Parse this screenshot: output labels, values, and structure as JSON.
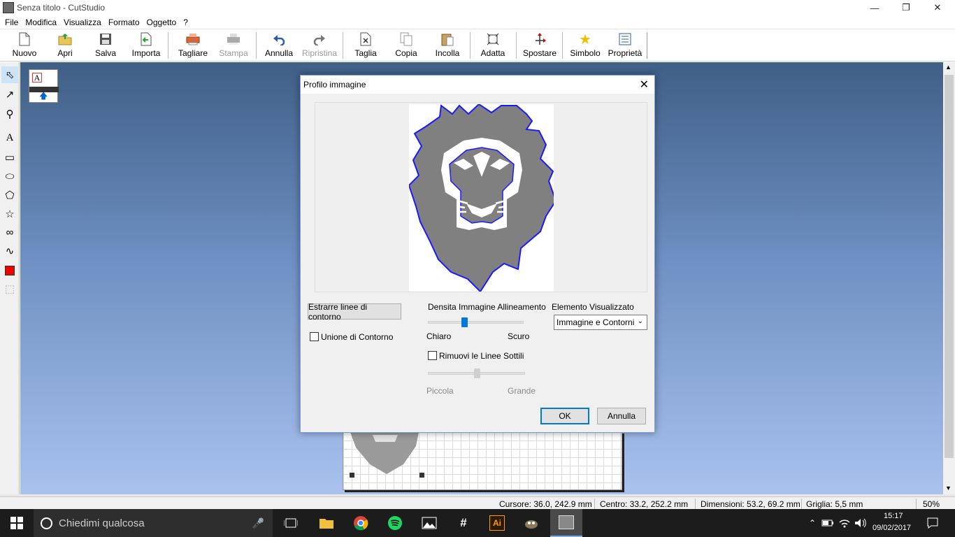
{
  "window": {
    "title": "Senza titolo - CutStudio"
  },
  "menu": [
    "File",
    "Modifica",
    "Visualizza",
    "Formato",
    "Oggetto",
    "?"
  ],
  "toolbar": {
    "new": "Nuovo",
    "open": "Apri",
    "save": "Salva",
    "import": "Importa",
    "cut_job": "Tagliare",
    "print": "Stampa",
    "undo": "Annulla",
    "redo": "Ripristina",
    "cut": "Taglia",
    "copy": "Copia",
    "paste": "Incolla",
    "fit": "Adatta",
    "move": "Spostare",
    "symbol": "Simbolo",
    "properties": "Proprietà"
  },
  "dialog": {
    "title": "Profilo immagine",
    "extract_button": "Estrarre linee di contorno",
    "union_label": "Unione di Contorno",
    "density_title": "Densita Immagine Allineamento",
    "density_min": "Chiaro",
    "density_max": "Scuro",
    "density_level": 0.38,
    "display_title": "Elemento Visualizzato",
    "display_value": "Immagine e Contorni",
    "thin_lines_label": "Rimuovi le Linee Sottili",
    "size_min": "Piccola",
    "size_max": "Grande",
    "size_level": 0.5,
    "ok": "OK",
    "cancel": "Annulla"
  },
  "status": {
    "cursor": "Cursore: 36.0, 242.9 mm",
    "center": "Centro: 33.2, 252.2 mm",
    "dimensions": "Dimensioni: 53.2, 69.2 mm",
    "grid": "Griglia: 5,5 mm",
    "zoom": "50%"
  },
  "taskbar": {
    "search_placeholder": "Chiedimi qualcosa",
    "ai_label": "Ai",
    "time": "15:17",
    "date": "09/02/2017"
  },
  "colors": {
    "lion_fill": "#808080",
    "lion_outline": "#1a1aff",
    "accent": "#0078d7",
    "canvas_top": "#3f5f86",
    "canvas_bottom": "#a9c2ee"
  }
}
